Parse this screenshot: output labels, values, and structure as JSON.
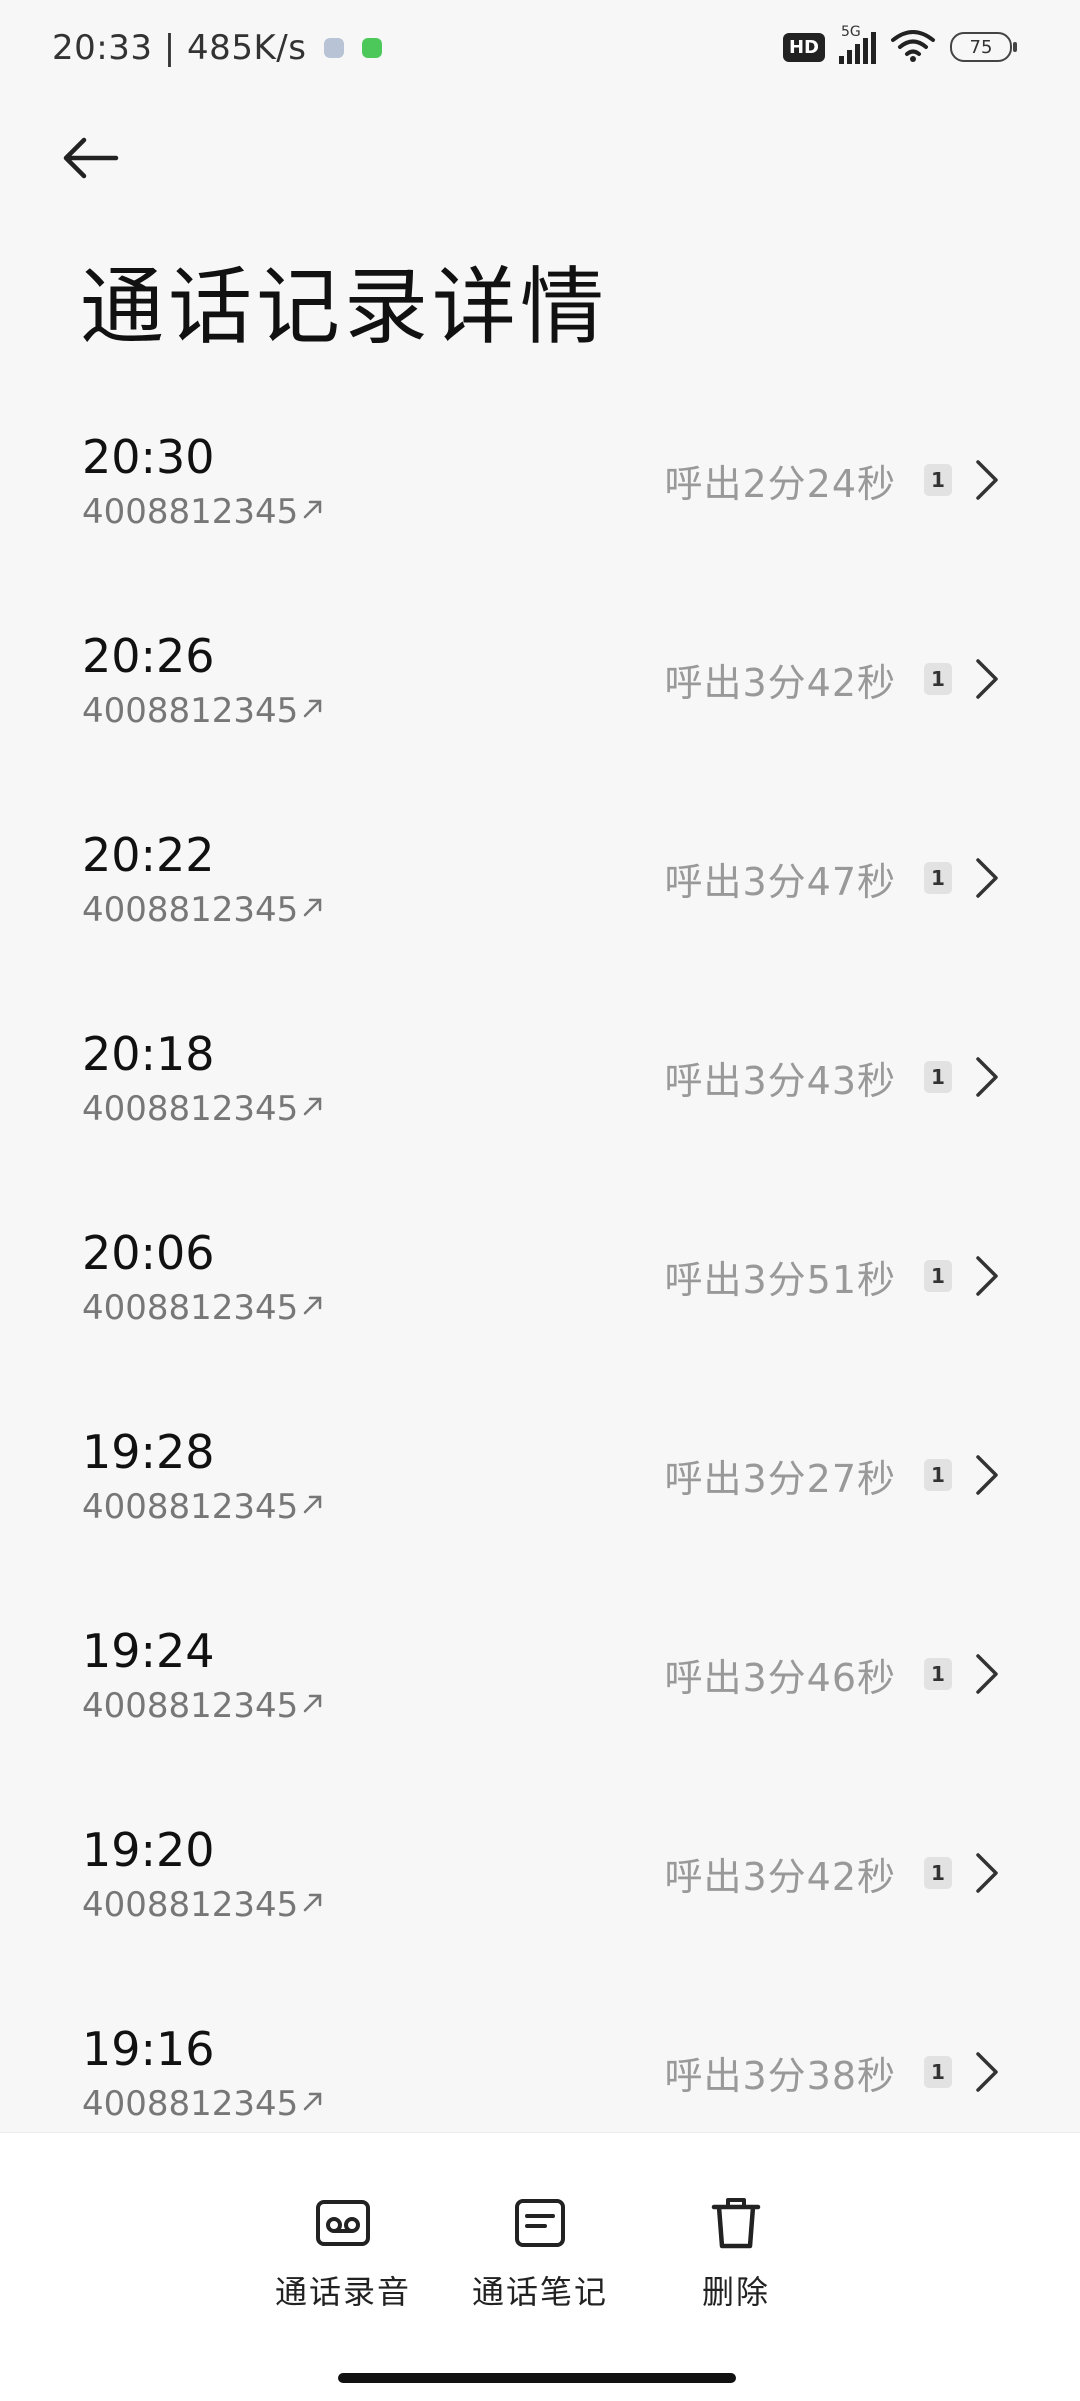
{
  "status_bar": {
    "time_speed": "20:33 | 485K/s",
    "hd_label": "HD",
    "network_label": "5G",
    "battery_level": "75"
  },
  "header": {
    "title": "通话记录详情"
  },
  "calls": [
    {
      "time": "20:30",
      "number": "4008812345",
      "duration": "呼出2分24秒",
      "sim": "1"
    },
    {
      "time": "20:26",
      "number": "4008812345",
      "duration": "呼出3分42秒",
      "sim": "1"
    },
    {
      "time": "20:22",
      "number": "4008812345",
      "duration": "呼出3分47秒",
      "sim": "1"
    },
    {
      "time": "20:18",
      "number": "4008812345",
      "duration": "呼出3分43秒",
      "sim": "1"
    },
    {
      "time": "20:06",
      "number": "4008812345",
      "duration": "呼出3分51秒",
      "sim": "1"
    },
    {
      "time": "19:28",
      "number": "4008812345",
      "duration": "呼出3分27秒",
      "sim": "1"
    },
    {
      "time": "19:24",
      "number": "4008812345",
      "duration": "呼出3分46秒",
      "sim": "1"
    },
    {
      "time": "19:20",
      "number": "4008812345",
      "duration": "呼出3分42秒",
      "sim": "1"
    },
    {
      "time": "19:16",
      "number": "4008812345",
      "duration": "呼出3分38秒",
      "sim": "1"
    }
  ],
  "bottom_actions": {
    "recording": "通话录音",
    "notes": "通话笔记",
    "delete": "删除"
  },
  "icons": {
    "back": "back-arrow-icon",
    "chevron": "chevron-right-icon",
    "outgoing": "outgoing-arrow-icon",
    "recording": "recording-icon",
    "notes": "notes-icon",
    "delete": "trash-icon"
  }
}
